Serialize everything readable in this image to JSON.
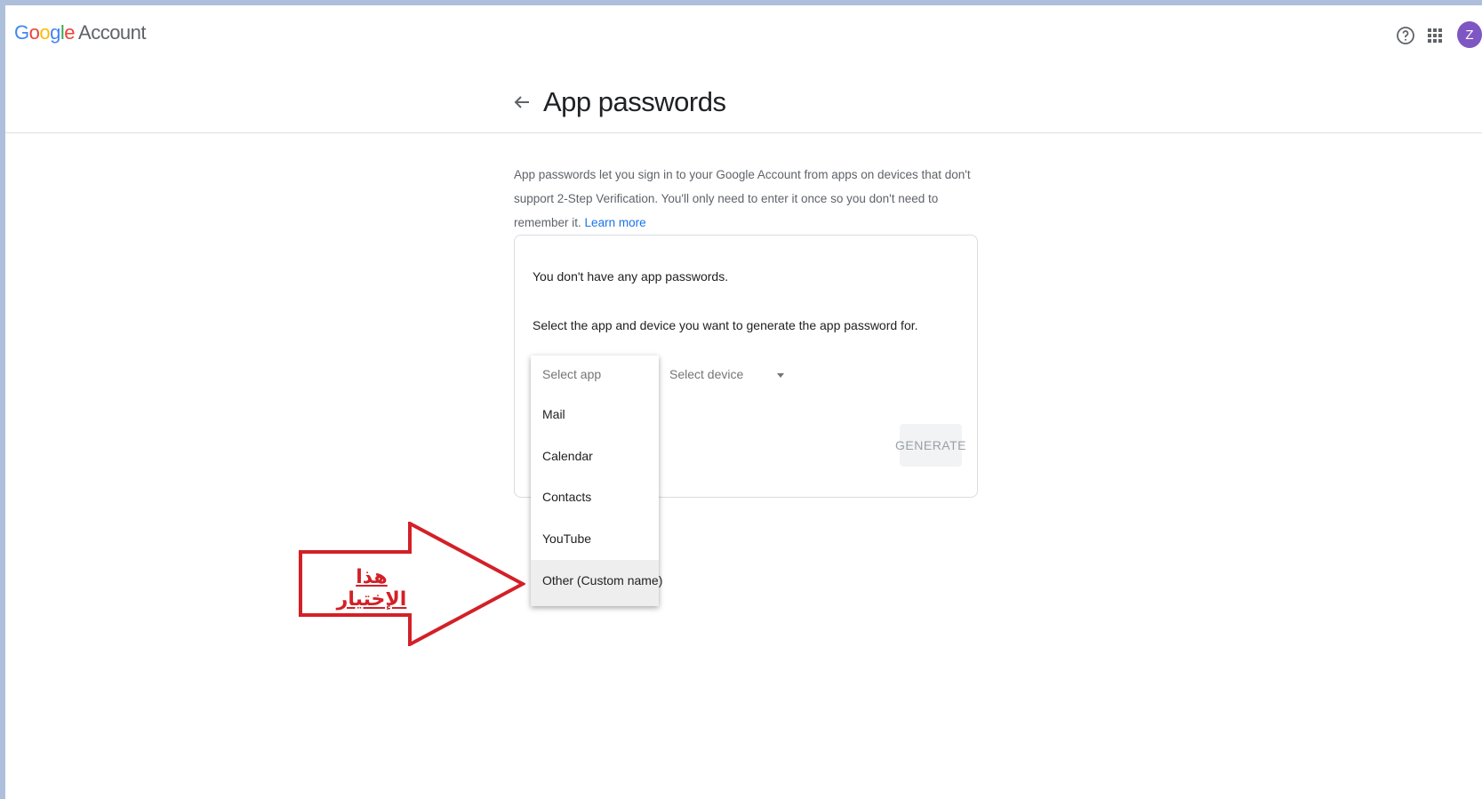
{
  "header": {
    "logo_letters": [
      "G",
      "o",
      "o",
      "g",
      "l",
      "e"
    ],
    "logo_word": "Account",
    "avatar_initial": "Z",
    "icons": [
      "help-icon",
      "apps-grid-icon"
    ],
    "colors": {
      "avatar": "#7e57c2",
      "link": "#1a73e8",
      "annotation": "#d32027"
    }
  },
  "page": {
    "title": "App passwords",
    "intro_text": "App passwords let you sign in to your Google Account from apps on devices that don't support 2-Step Verification. You'll only need to enter it once so you don't need to remember it.",
    "learn_more": "Learn more"
  },
  "card": {
    "empty_message": "You don't have any app passwords.",
    "instruction": "Select the app and device you want to generate the app password for.",
    "device_placeholder": "Select device",
    "generate_label": "GENERATE"
  },
  "app_dropdown": {
    "placeholder": "Select app",
    "options": [
      "Mail",
      "Calendar",
      "Contacts",
      "YouTube",
      "Other (Custom name)"
    ],
    "highlighted_option": "Other (Custom name)"
  },
  "annotation": {
    "label": "هذا الإختيار"
  }
}
